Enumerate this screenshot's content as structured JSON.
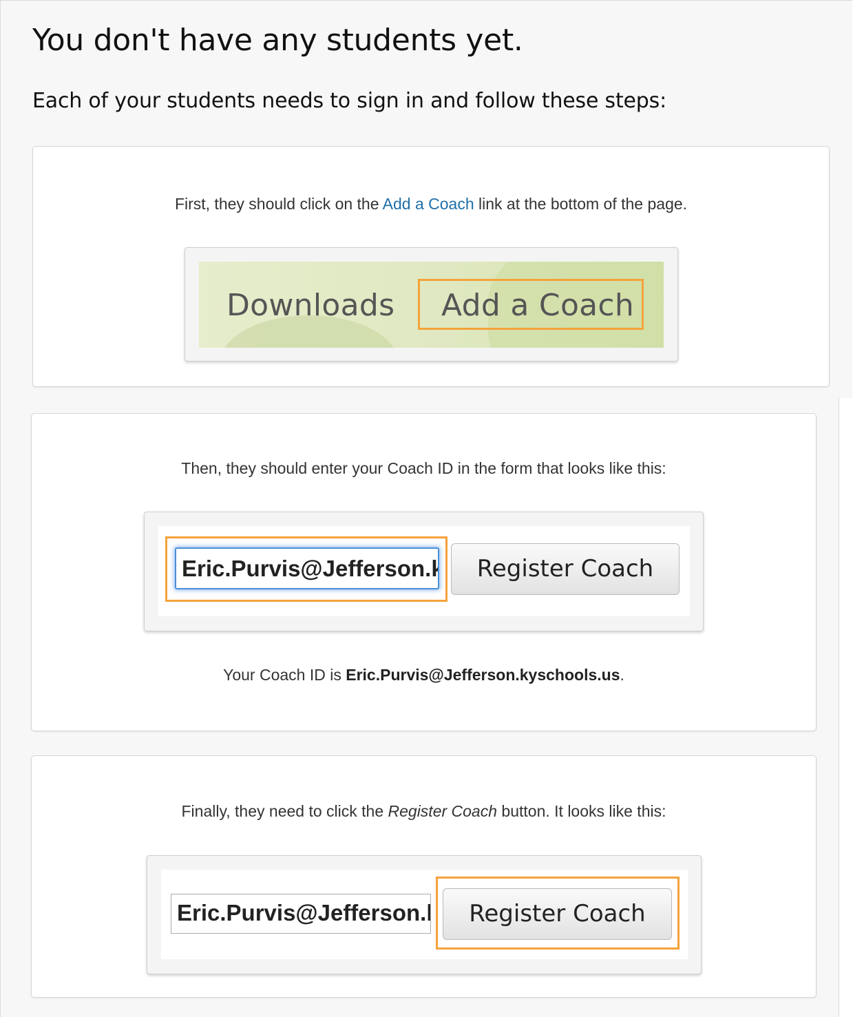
{
  "heading": "You don't have any students yet.",
  "subheading": "Each of your students needs to sign in and follow these steps:",
  "step1": {
    "text_before": "First, they should click on the ",
    "link": "Add a Coach",
    "text_after": " link at the bottom of the page.",
    "footer_links": [
      "Downloads",
      "Add a Coach"
    ]
  },
  "step2": {
    "text": "Then, they should enter your Coach ID in the form that looks like this:",
    "input_value": "Eric.Purvis@Jefferson.kyschools.us",
    "button_label": "Register Coach",
    "coach_id_prefix": "Your Coach ID is ",
    "coach_id": "Eric.Purvis@Jefferson.kyschools.us",
    "coach_id_suffix": "."
  },
  "step3": {
    "text_before": "Finally, they need to click the ",
    "emphasis": "Register Coach",
    "text_after": " button. It looks like this:",
    "input_value": "Eric.Purvis@Jefferson.kyschools.us",
    "button_label": "Register Coach"
  },
  "colors": {
    "highlight": "#f5a23a",
    "link": "#1f6fa8",
    "focus": "#4a8fd9"
  }
}
